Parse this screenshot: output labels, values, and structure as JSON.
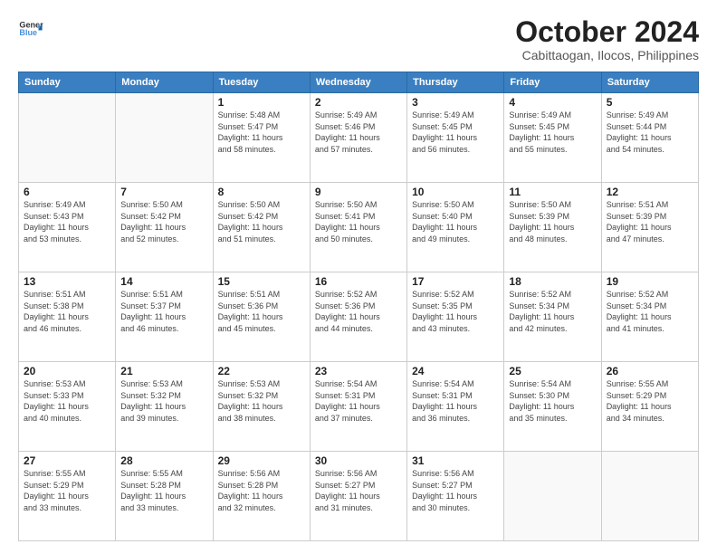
{
  "header": {
    "logo_line1": "General",
    "logo_line2": "Blue",
    "month": "October 2024",
    "location": "Cabittaogan, Ilocos, Philippines"
  },
  "weekdays": [
    "Sunday",
    "Monday",
    "Tuesday",
    "Wednesday",
    "Thursday",
    "Friday",
    "Saturday"
  ],
  "weeks": [
    [
      {
        "day": "",
        "info": ""
      },
      {
        "day": "",
        "info": ""
      },
      {
        "day": "1",
        "info": "Sunrise: 5:48 AM\nSunset: 5:47 PM\nDaylight: 11 hours\nand 58 minutes."
      },
      {
        "day": "2",
        "info": "Sunrise: 5:49 AM\nSunset: 5:46 PM\nDaylight: 11 hours\nand 57 minutes."
      },
      {
        "day": "3",
        "info": "Sunrise: 5:49 AM\nSunset: 5:45 PM\nDaylight: 11 hours\nand 56 minutes."
      },
      {
        "day": "4",
        "info": "Sunrise: 5:49 AM\nSunset: 5:45 PM\nDaylight: 11 hours\nand 55 minutes."
      },
      {
        "day": "5",
        "info": "Sunrise: 5:49 AM\nSunset: 5:44 PM\nDaylight: 11 hours\nand 54 minutes."
      }
    ],
    [
      {
        "day": "6",
        "info": "Sunrise: 5:49 AM\nSunset: 5:43 PM\nDaylight: 11 hours\nand 53 minutes."
      },
      {
        "day": "7",
        "info": "Sunrise: 5:50 AM\nSunset: 5:42 PM\nDaylight: 11 hours\nand 52 minutes."
      },
      {
        "day": "8",
        "info": "Sunrise: 5:50 AM\nSunset: 5:42 PM\nDaylight: 11 hours\nand 51 minutes."
      },
      {
        "day": "9",
        "info": "Sunrise: 5:50 AM\nSunset: 5:41 PM\nDaylight: 11 hours\nand 50 minutes."
      },
      {
        "day": "10",
        "info": "Sunrise: 5:50 AM\nSunset: 5:40 PM\nDaylight: 11 hours\nand 49 minutes."
      },
      {
        "day": "11",
        "info": "Sunrise: 5:50 AM\nSunset: 5:39 PM\nDaylight: 11 hours\nand 48 minutes."
      },
      {
        "day": "12",
        "info": "Sunrise: 5:51 AM\nSunset: 5:39 PM\nDaylight: 11 hours\nand 47 minutes."
      }
    ],
    [
      {
        "day": "13",
        "info": "Sunrise: 5:51 AM\nSunset: 5:38 PM\nDaylight: 11 hours\nand 46 minutes."
      },
      {
        "day": "14",
        "info": "Sunrise: 5:51 AM\nSunset: 5:37 PM\nDaylight: 11 hours\nand 46 minutes."
      },
      {
        "day": "15",
        "info": "Sunrise: 5:51 AM\nSunset: 5:36 PM\nDaylight: 11 hours\nand 45 minutes."
      },
      {
        "day": "16",
        "info": "Sunrise: 5:52 AM\nSunset: 5:36 PM\nDaylight: 11 hours\nand 44 minutes."
      },
      {
        "day": "17",
        "info": "Sunrise: 5:52 AM\nSunset: 5:35 PM\nDaylight: 11 hours\nand 43 minutes."
      },
      {
        "day": "18",
        "info": "Sunrise: 5:52 AM\nSunset: 5:34 PM\nDaylight: 11 hours\nand 42 minutes."
      },
      {
        "day": "19",
        "info": "Sunrise: 5:52 AM\nSunset: 5:34 PM\nDaylight: 11 hours\nand 41 minutes."
      }
    ],
    [
      {
        "day": "20",
        "info": "Sunrise: 5:53 AM\nSunset: 5:33 PM\nDaylight: 11 hours\nand 40 minutes."
      },
      {
        "day": "21",
        "info": "Sunrise: 5:53 AM\nSunset: 5:32 PM\nDaylight: 11 hours\nand 39 minutes."
      },
      {
        "day": "22",
        "info": "Sunrise: 5:53 AM\nSunset: 5:32 PM\nDaylight: 11 hours\nand 38 minutes."
      },
      {
        "day": "23",
        "info": "Sunrise: 5:54 AM\nSunset: 5:31 PM\nDaylight: 11 hours\nand 37 minutes."
      },
      {
        "day": "24",
        "info": "Sunrise: 5:54 AM\nSunset: 5:31 PM\nDaylight: 11 hours\nand 36 minutes."
      },
      {
        "day": "25",
        "info": "Sunrise: 5:54 AM\nSunset: 5:30 PM\nDaylight: 11 hours\nand 35 minutes."
      },
      {
        "day": "26",
        "info": "Sunrise: 5:55 AM\nSunset: 5:29 PM\nDaylight: 11 hours\nand 34 minutes."
      }
    ],
    [
      {
        "day": "27",
        "info": "Sunrise: 5:55 AM\nSunset: 5:29 PM\nDaylight: 11 hours\nand 33 minutes."
      },
      {
        "day": "28",
        "info": "Sunrise: 5:55 AM\nSunset: 5:28 PM\nDaylight: 11 hours\nand 33 minutes."
      },
      {
        "day": "29",
        "info": "Sunrise: 5:56 AM\nSunset: 5:28 PM\nDaylight: 11 hours\nand 32 minutes."
      },
      {
        "day": "30",
        "info": "Sunrise: 5:56 AM\nSunset: 5:27 PM\nDaylight: 11 hours\nand 31 minutes."
      },
      {
        "day": "31",
        "info": "Sunrise: 5:56 AM\nSunset: 5:27 PM\nDaylight: 11 hours\nand 30 minutes."
      },
      {
        "day": "",
        "info": ""
      },
      {
        "day": "",
        "info": ""
      }
    ]
  ]
}
